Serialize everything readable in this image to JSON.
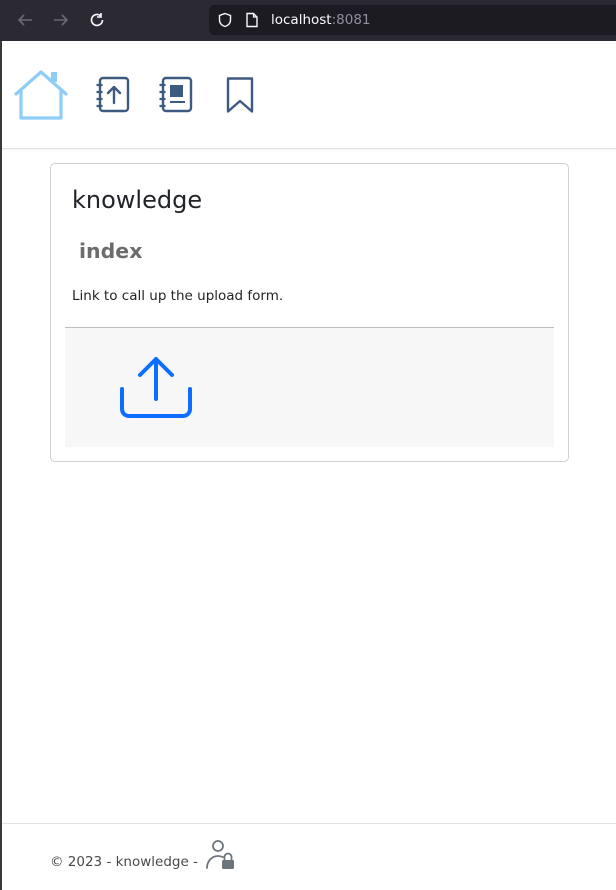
{
  "browser": {
    "url_host": "localhost",
    "url_port": ":8081"
  },
  "nav": {
    "items": [
      {
        "icon": "home-icon",
        "active": true
      },
      {
        "icon": "notebook-upload-icon"
      },
      {
        "icon": "notebook-icon"
      },
      {
        "icon": "bookmark-icon"
      }
    ]
  },
  "card": {
    "title": "knowledge",
    "subtitle": "index",
    "text": "Link to call up the upload form.",
    "action_icon": "upload-icon"
  },
  "footer": {
    "text": "© 2023 - knowledge -",
    "login_icon": "user-lock-icon"
  },
  "colors": {
    "browser_chrome": "#2b2a33",
    "nav_icon": "#3d5a80",
    "home_active": "#8ecdf7",
    "upload_accent": "#0d6efd"
  }
}
